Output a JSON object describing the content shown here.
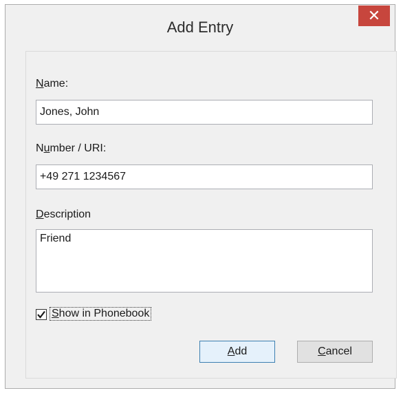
{
  "window": {
    "title": "Add Entry",
    "close_glyph": "✕"
  },
  "form": {
    "name": {
      "label_underlined": "N",
      "label_rest": "ame:",
      "value": "Jones, John"
    },
    "number": {
      "label_pre": "N",
      "label_underlined": "u",
      "label_rest": "mber / URI:",
      "value": "+49 271 1234567"
    },
    "description": {
      "label_underlined": "D",
      "label_rest": "escription",
      "value": "Friend"
    },
    "show_in_phonebook": {
      "checked": true,
      "label_underlined": "S",
      "label_rest": "how in Phonebook"
    }
  },
  "buttons": {
    "add": {
      "label_underlined": "A",
      "label_rest": "dd"
    },
    "cancel": {
      "label_underlined": "C",
      "label_rest": "ancel"
    }
  }
}
